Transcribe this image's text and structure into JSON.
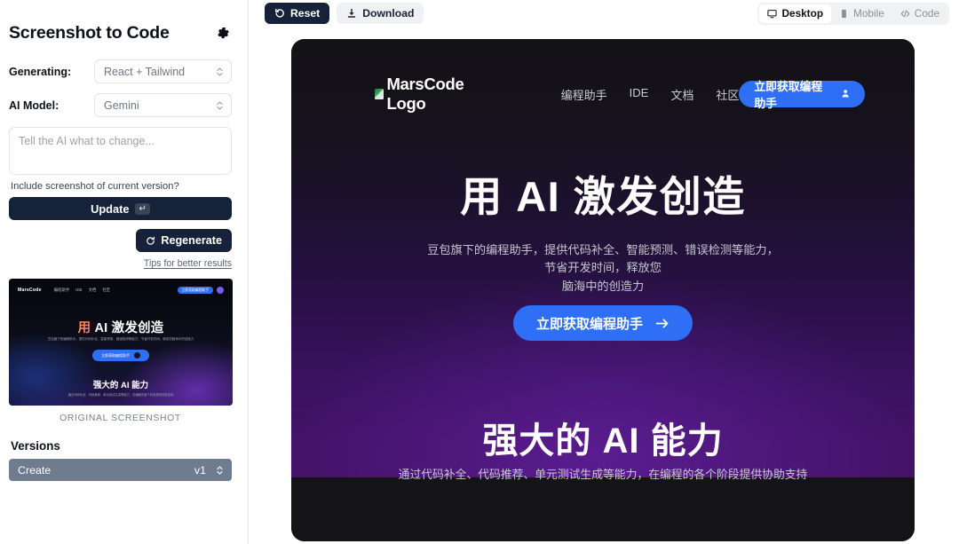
{
  "sidebar": {
    "title": "Screenshot to Code",
    "settings_icon": "gear-icon",
    "generating_label": "Generating:",
    "generating_value": "React + Tailwind",
    "model_label": "AI Model:",
    "model_value": "Gemini",
    "instruction_placeholder": "Tell the AI what to change...",
    "include_screenshot_label": "Include screenshot of current version?",
    "update_label": "Update",
    "update_key_hint": "↵",
    "regenerate_label": "Regenerate",
    "regenerate_icon": "refresh-icon",
    "tips_link": "Tips for better results",
    "thumbnail_caption": "ORIGINAL SCREENSHOT",
    "versions_title": "Versions",
    "version_row": {
      "name": "Create",
      "version": "v1"
    }
  },
  "thumbnail": {
    "logo": "MarsCode",
    "links": [
      "编程助手",
      "IDE",
      "文档",
      "社区"
    ],
    "cta": "立即获取编程助手",
    "h1_accent": "用",
    "h1_rest": " AI 激发创造",
    "sub": "豆包旗下的编程助手，提供代码补全、智能预测、错误检测等能力，节省开发时间，释放您脑海中的创造力",
    "btn": "立即获取编程助手",
    "h2": "强大的 AI 能力",
    "sub2": "通过代码补全、代码推荐、单元测试生成等能力，在编程的各个阶段提供协助支持"
  },
  "toolbar": {
    "reset_label": "Reset",
    "reset_icon": "undo-icon",
    "download_label": "Download",
    "download_icon": "download-icon",
    "views": [
      {
        "label": "Desktop",
        "icon": "monitor-icon",
        "active": true
      },
      {
        "label": "Mobile",
        "icon": "phone-icon",
        "active": false
      },
      {
        "label": "Code",
        "icon": "code-icon",
        "active": false
      }
    ]
  },
  "preview": {
    "brand_text": "MarsCode Logo",
    "brand_icon": "broken-image-icon",
    "nav_links": [
      "编程助手",
      "IDE",
      "文档",
      "社区"
    ],
    "header_cta": "立即获取编程助手",
    "header_cta_icon": "person-icon",
    "hero_heading": "用 AI 激发创造",
    "hero_sub_line1": "豆包旗下的编程助手，提供代码补全、智能预测、错误检测等能力，节省开发时间，释放您",
    "hero_sub_line2": "脑海中的创造力",
    "hero_cta": "立即获取编程助手",
    "hero_cta_icon": "arrow-right-icon",
    "section2_heading": "强大的 AI 能力",
    "section2_sub": "通过代码补全、代码推荐、单元测试生成等能力，在编程的各个阶段提供协助支持"
  },
  "colors": {
    "accent_blue": "#2f6ff5",
    "dark_button": "#16213a",
    "version_row": "#6f7b8f",
    "preview_purple": "#431368"
  }
}
